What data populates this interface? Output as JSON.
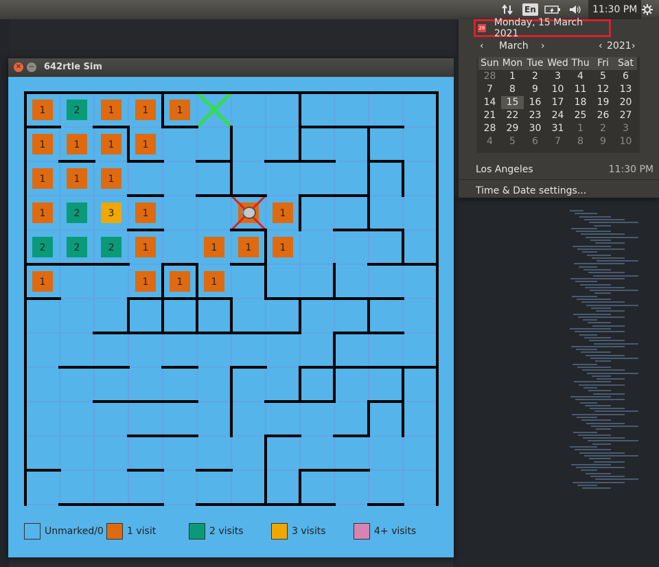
{
  "panel": {
    "language": "En",
    "clock": "11:30 PM"
  },
  "calendar": {
    "date_header": "Monday, 15 March 2021",
    "month": "March",
    "year": "2021",
    "prev_symbol": "‹",
    "next_symbol": "›",
    "weekdays": [
      "Sun",
      "Mon",
      "Tue",
      "Wed",
      "Thu",
      "Fri",
      "Sat"
    ],
    "weeks": [
      [
        {
          "d": "28",
          "o": true
        },
        {
          "d": "1"
        },
        {
          "d": "2"
        },
        {
          "d": "3"
        },
        {
          "d": "4"
        },
        {
          "d": "5"
        },
        {
          "d": "6"
        }
      ],
      [
        {
          "d": "7"
        },
        {
          "d": "8"
        },
        {
          "d": "9"
        },
        {
          "d": "10"
        },
        {
          "d": "11"
        },
        {
          "d": "12"
        },
        {
          "d": "13"
        }
      ],
      [
        {
          "d": "14"
        },
        {
          "d": "15",
          "today": true
        },
        {
          "d": "16"
        },
        {
          "d": "17"
        },
        {
          "d": "18"
        },
        {
          "d": "19"
        },
        {
          "d": "20"
        }
      ],
      [
        {
          "d": "21"
        },
        {
          "d": "22"
        },
        {
          "d": "23"
        },
        {
          "d": "24"
        },
        {
          "d": "25"
        },
        {
          "d": "26"
        },
        {
          "d": "27"
        }
      ],
      [
        {
          "d": "28"
        },
        {
          "d": "29"
        },
        {
          "d": "30"
        },
        {
          "d": "31"
        },
        {
          "d": "1",
          "o": true
        },
        {
          "d": "2",
          "o": true
        },
        {
          "d": "3",
          "o": true
        }
      ],
      [
        {
          "d": "4",
          "o": true
        },
        {
          "d": "5",
          "o": true
        },
        {
          "d": "6",
          "o": true
        },
        {
          "d": "7",
          "o": true
        },
        {
          "d": "8",
          "o": true
        },
        {
          "d": "9",
          "o": true
        },
        {
          "d": "10",
          "o": true
        }
      ]
    ],
    "location": "Los Angeles",
    "location_time": "11:30 PM",
    "settings_label": "Time & Date settings..."
  },
  "sim": {
    "title": "642rtle Sim",
    "colors": {
      "floor": "#55b4e9",
      "visit1": "#e06a10",
      "visit2": "#0a9a78",
      "visit3": "#f0a800",
      "visit4": "#d684b0",
      "goal": "#2ee52e",
      "start": "#e02020"
    },
    "grid_rows": 12,
    "grid_cols": 12,
    "cells": [
      {
        "r": 0,
        "c": 0,
        "v": 1
      },
      {
        "r": 0,
        "c": 1,
        "v": 2
      },
      {
        "r": 0,
        "c": 2,
        "v": 1
      },
      {
        "r": 0,
        "c": 3,
        "v": 1
      },
      {
        "r": 0,
        "c": 4,
        "v": 1
      },
      {
        "r": 1,
        "c": 0,
        "v": 1
      },
      {
        "r": 1,
        "c": 1,
        "v": 1
      },
      {
        "r": 1,
        "c": 2,
        "v": 1
      },
      {
        "r": 1,
        "c": 3,
        "v": 1
      },
      {
        "r": 2,
        "c": 0,
        "v": 1
      },
      {
        "r": 2,
        "c": 1,
        "v": 1
      },
      {
        "r": 2,
        "c": 2,
        "v": 1
      },
      {
        "r": 3,
        "c": 0,
        "v": 1
      },
      {
        "r": 3,
        "c": 1,
        "v": 2
      },
      {
        "r": 3,
        "c": 2,
        "v": 3
      },
      {
        "r": 3,
        "c": 3,
        "v": 1
      },
      {
        "r": 3,
        "c": 6,
        "v": 1
      },
      {
        "r": 3,
        "c": 7,
        "v": 1
      },
      {
        "r": 4,
        "c": 0,
        "v": 2
      },
      {
        "r": 4,
        "c": 1,
        "v": 2
      },
      {
        "r": 4,
        "c": 2,
        "v": 2
      },
      {
        "r": 4,
        "c": 3,
        "v": 1
      },
      {
        "r": 4,
        "c": 5,
        "v": 1
      },
      {
        "r": 4,
        "c": 6,
        "v": 1
      },
      {
        "r": 4,
        "c": 7,
        "v": 1
      },
      {
        "r": 5,
        "c": 0,
        "v": 1
      },
      {
        "r": 5,
        "c": 3,
        "v": 1
      },
      {
        "r": 5,
        "c": 4,
        "v": 1
      },
      {
        "r": 5,
        "c": 5,
        "v": 1
      }
    ],
    "goal_cell": {
      "r": 0,
      "c": 5
    },
    "turtle_cell": {
      "r": 3,
      "c": 6
    },
    "walls_h": [
      [
        0,
        0,
        12
      ],
      [
        1,
        0,
        1
      ],
      [
        1,
        2,
        1
      ],
      [
        1,
        4,
        1
      ],
      [
        1,
        8,
        3
      ],
      [
        2,
        1,
        1
      ],
      [
        2,
        3,
        1
      ],
      [
        2,
        5,
        1
      ],
      [
        2,
        7,
        2
      ],
      [
        2,
        10,
        1
      ],
      [
        3,
        3,
        1
      ],
      [
        3,
        5,
        2
      ],
      [
        3,
        8,
        2
      ],
      [
        4,
        3,
        1
      ],
      [
        4,
        6,
        1
      ],
      [
        4,
        9,
        2
      ],
      [
        5,
        0,
        3
      ],
      [
        5,
        4,
        1
      ],
      [
        5,
        6,
        1
      ],
      [
        5,
        10,
        2
      ],
      [
        6,
        0,
        1
      ],
      [
        6,
        3,
        3
      ],
      [
        6,
        7,
        4
      ],
      [
        7,
        2,
        5
      ],
      [
        7,
        7,
        1
      ],
      [
        7,
        9,
        2
      ],
      [
        8,
        1,
        2
      ],
      [
        8,
        4,
        1
      ],
      [
        8,
        6,
        1
      ],
      [
        8,
        8,
        4
      ],
      [
        9,
        2,
        3
      ],
      [
        9,
        7,
        2
      ],
      [
        9,
        10,
        1
      ],
      [
        10,
        3,
        2
      ],
      [
        10,
        7,
        1
      ],
      [
        10,
        9,
        1
      ],
      [
        11,
        0,
        1
      ],
      [
        11,
        3,
        1
      ],
      [
        11,
        5,
        1
      ],
      [
        11,
        8,
        2
      ],
      [
        12,
        1,
        2
      ],
      [
        12,
        3,
        1
      ],
      [
        12,
        5,
        4
      ],
      [
        12,
        10,
        1
      ],
      [
        13,
        0,
        12
      ]
    ],
    "walls_v": [
      [
        0,
        0,
        12
      ],
      [
        3,
        1,
        1
      ],
      [
        3,
        6,
        1
      ],
      [
        4,
        0,
        1
      ],
      [
        4,
        5,
        2
      ],
      [
        5,
        5,
        2
      ],
      [
        6,
        1,
        2
      ],
      [
        6,
        6,
        1
      ],
      [
        6,
        8,
        2
      ],
      [
        7,
        4,
        2
      ],
      [
        7,
        10,
        2
      ],
      [
        8,
        0,
        2
      ],
      [
        8,
        3,
        1
      ],
      [
        8,
        6,
        1
      ],
      [
        8,
        8,
        1
      ],
      [
        8,
        11,
        1
      ],
      [
        9,
        5,
        1
      ],
      [
        9,
        7,
        2
      ],
      [
        10,
        1,
        3
      ],
      [
        10,
        6,
        1
      ],
      [
        10,
        9,
        1
      ],
      [
        11,
        2,
        1
      ],
      [
        11,
        4,
        1
      ],
      [
        11,
        8,
        2
      ],
      [
        12,
        0,
        12
      ]
    ],
    "legend": [
      {
        "label": "Unmarked/0",
        "color": "#55b4e9"
      },
      {
        "label": "1 visit",
        "color": "#e06a10"
      },
      {
        "label": "2 visits",
        "color": "#0a9a78"
      },
      {
        "label": "3 visits",
        "color": "#f0a800"
      },
      {
        "label": "4+ visits",
        "color": "#d684b0"
      }
    ]
  }
}
